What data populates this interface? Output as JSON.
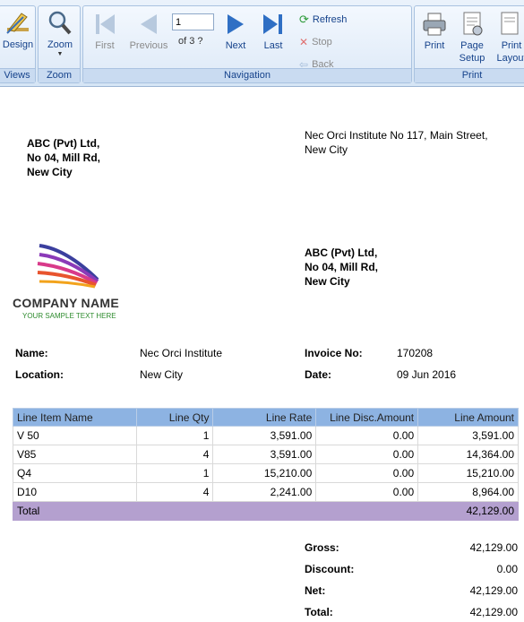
{
  "ribbon": {
    "views": {
      "label": "Views",
      "design_label": "Design"
    },
    "zoom": {
      "label": "Zoom",
      "zoom_label": "Zoom"
    },
    "navigation": {
      "label": "Navigation",
      "first_label": "First",
      "previous_label": "Previous",
      "page_value": "1",
      "page_of": "of  3 ?",
      "next_label": "Next",
      "last_label": "Last",
      "refresh_label": "Refresh",
      "stop_label": "Stop",
      "back_label": "Back"
    },
    "print": {
      "label": "Print",
      "print_label": "Print",
      "page_setup_label": "Page\nSetup",
      "print_layout_label": "Print\nLayout"
    }
  },
  "report": {
    "sender": {
      "line1": "ABC (Pvt) Ltd,",
      "line2": "No 04, Mill Rd,",
      "line3": "New City"
    },
    "recipient_header": {
      "line1": "Nec Orci Institute No 117,  Main Street,",
      "line2": "New City"
    },
    "company_block": {
      "line1": "ABC (Pvt) Ltd,",
      "line2": "No 04, Mill Rd,",
      "line3": "New City"
    },
    "logo": {
      "name": "COMPANY NAME",
      "tagline": "YOUR SAMPLE TEXT HERE"
    },
    "name_label": "Name:",
    "name_value": "Nec Orci Institute",
    "location_label": "Location:",
    "location_value": "New City",
    "invoice_label": "Invoice No:",
    "invoice_value": "170208",
    "date_label": "Date:",
    "date_value": "09 Jun 2016",
    "table": {
      "headers": [
        "Line Item Name",
        "Line Qty",
        "Line Rate",
        "Line Disc.Amount",
        "Line Amount"
      ],
      "rows": [
        [
          "V 50",
          "1",
          "3,591.00",
          "0.00",
          "3,591.00"
        ],
        [
          "V85",
          "4",
          "3,591.00",
          "0.00",
          "14,364.00"
        ],
        [
          "Q4",
          "1",
          "15,210.00",
          "0.00",
          "15,210.00"
        ],
        [
          "D10",
          "4",
          "2,241.00",
          "0.00",
          "8,964.00"
        ]
      ],
      "total_label": "Total",
      "total_value": "42,129.00"
    },
    "summary": {
      "gross_label": "Gross:",
      "gross_value": "42,129.00",
      "discount_label": "Discount:",
      "discount_value": "0.00",
      "net_label": "Net:",
      "net_value": "42,129.00",
      "total_label": "Total:",
      "total_value": "42,129.00"
    }
  },
  "colors": {
    "ribbon_text": "#15428b",
    "table_header": "#8db3e2",
    "total_row": "#b4a0cf",
    "tagline": "#2e8b2e"
  }
}
